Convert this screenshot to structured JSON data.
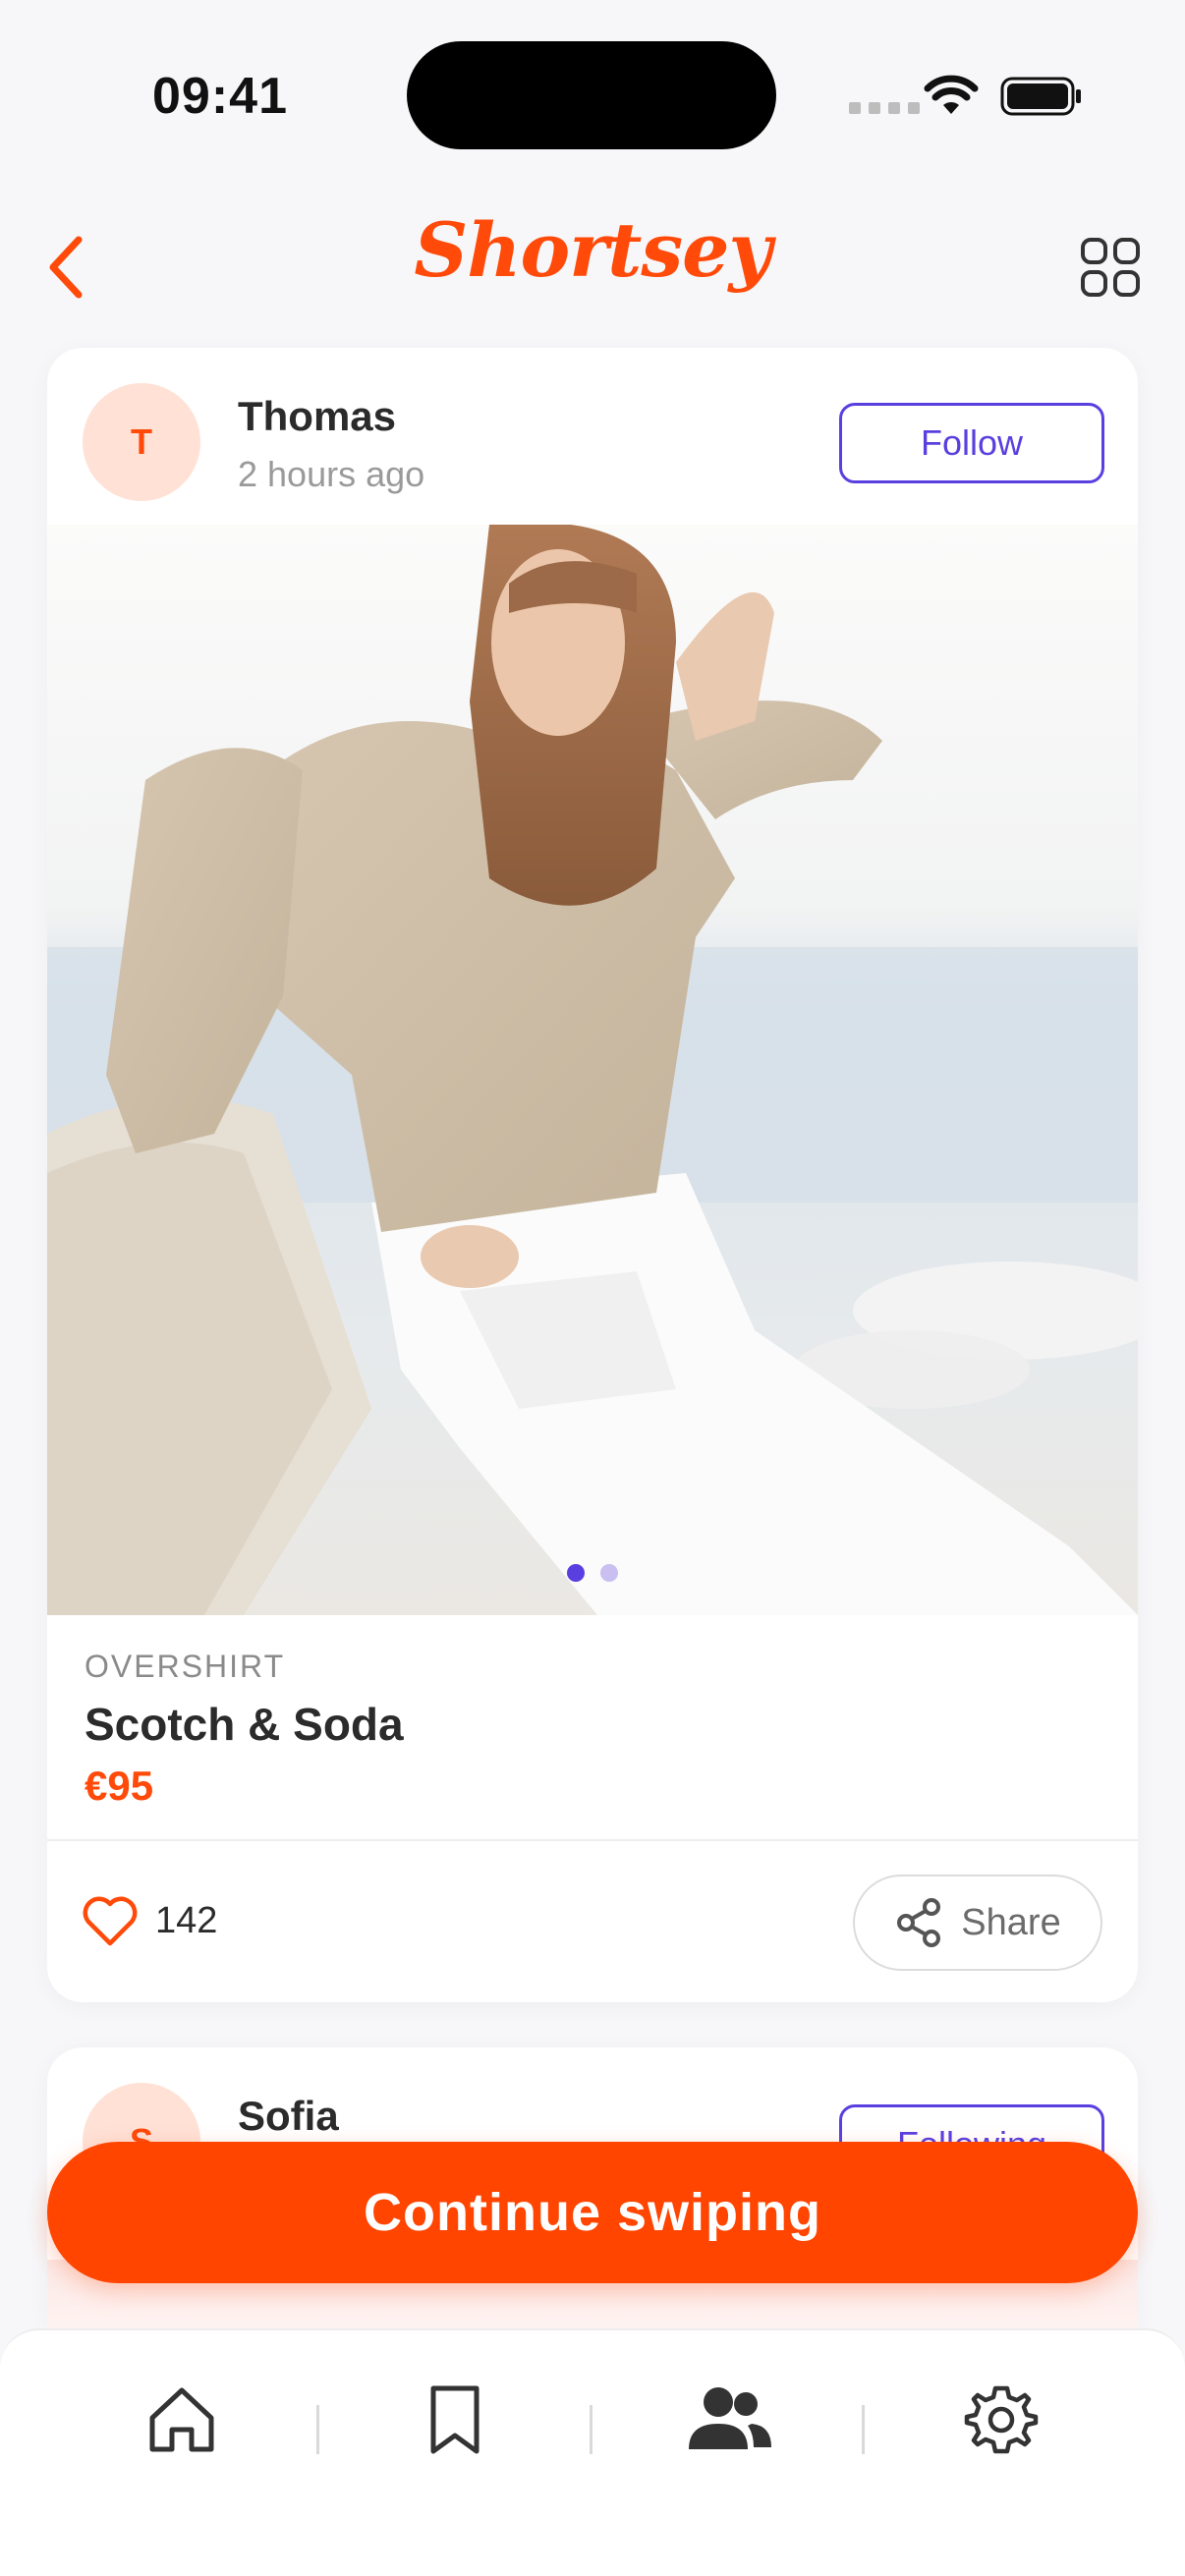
{
  "status_bar": {
    "time": "09:41"
  },
  "header": {
    "brand": "Shortsey"
  },
  "post": {
    "user": {
      "initial": "T",
      "name": "Thomas",
      "time": "2 hours ago"
    },
    "follow_label": "Follow",
    "product": {
      "category": "OVERSHIRT",
      "brand": "Scotch & Soda",
      "price": "€95"
    },
    "likes": "142",
    "share_label": "Share",
    "image_pages": {
      "count": 2,
      "active": 1
    }
  },
  "next_post": {
    "user": {
      "initial": "S",
      "name": "Sofia"
    },
    "follow_label": "Following"
  },
  "continue_label": "Continue swiping",
  "tabs": [
    {
      "icon": "home-icon",
      "active": false
    },
    {
      "icon": "bookmark-icon",
      "active": false
    },
    {
      "icon": "people-icon",
      "active": true
    },
    {
      "icon": "settings-icon",
      "active": false
    }
  ],
  "colors": {
    "accent": "#ff4a0a",
    "primary_purple": "#5a3fe0",
    "button": "#ff4500"
  }
}
